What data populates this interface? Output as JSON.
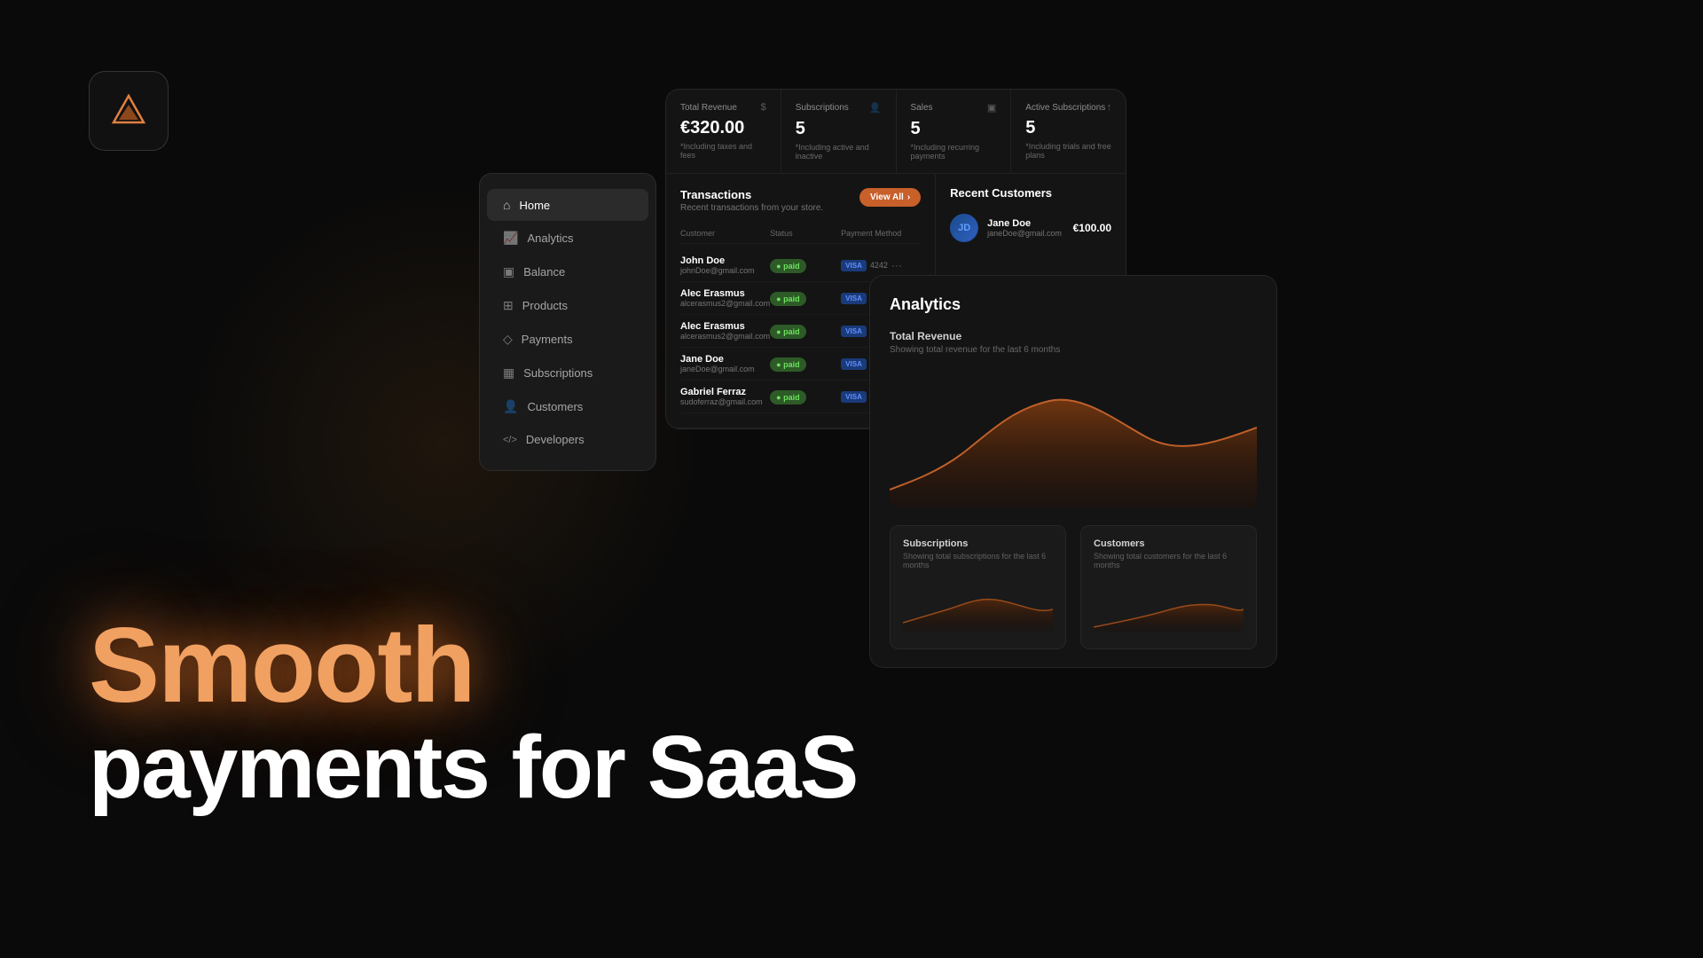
{
  "background": {
    "color": "#0a0a0a"
  },
  "logo": {
    "alt": "Volt logo"
  },
  "hero": {
    "line1": "Smooth",
    "line2": "payments for SaaS"
  },
  "sidebar": {
    "items": [
      {
        "id": "home",
        "label": "Home",
        "icon": "⌂",
        "active": true
      },
      {
        "id": "analytics",
        "label": "Analytics",
        "icon": "📈",
        "active": false
      },
      {
        "id": "balance",
        "label": "Balance",
        "icon": "▣",
        "active": false
      },
      {
        "id": "products",
        "label": "Products",
        "icon": "⊞",
        "active": false
      },
      {
        "id": "payments",
        "label": "Payments",
        "icon": "◇",
        "active": false
      },
      {
        "id": "subscriptions",
        "label": "Subscriptions",
        "icon": "▦",
        "active": false
      },
      {
        "id": "customers",
        "label": "Customers",
        "icon": "👤",
        "active": false
      },
      {
        "id": "developers",
        "label": "Developers",
        "icon": "</>",
        "active": false
      }
    ]
  },
  "stats": [
    {
      "label": "Total Revenue",
      "icon": "$",
      "value": "€320.00",
      "desc": "*Including taxes and fees"
    },
    {
      "label": "Subscriptions",
      "icon": "👤",
      "value": "5",
      "desc": "*Including active and inactive"
    },
    {
      "label": "Sales",
      "icon": "▣",
      "value": "5",
      "desc": "*Including recurring payments"
    },
    {
      "label": "Active Subscriptions",
      "icon": "↑",
      "value": "5",
      "desc": "*Including trials and free plans"
    }
  ],
  "transactions": {
    "title": "Transactions",
    "subtitle": "Recent transactions from your store.",
    "view_all_label": "View All",
    "columns": [
      "Customer",
      "Status",
      "Payment Method"
    ],
    "rows": [
      {
        "name": "John Doe",
        "email": "johnDoe@gmail.com",
        "status": "paid",
        "method": "visa",
        "card": "4242"
      },
      {
        "name": "Alec Erasmus",
        "email": "alcerasmus2@gmail.com",
        "status": "paid",
        "method": "visa",
        "card": ""
      },
      {
        "name": "Alec Erasmus",
        "email": "alcerasmus2@gmail.com",
        "status": "paid",
        "method": "visa",
        "card": ""
      },
      {
        "name": "Jane Doe",
        "email": "janeDoe@gmail.com",
        "status": "paid",
        "method": "visa",
        "card": ""
      },
      {
        "name": "Gabriel Ferraz",
        "email": "sudoferraz@gmail.com",
        "status": "paid",
        "method": "visa",
        "card": ""
      }
    ]
  },
  "recent_customers": {
    "title": "Recent Customers",
    "customers": [
      {
        "name": "Jane Doe",
        "email": "janeDoe@gmail.com",
        "amount": "€100.00",
        "initials": "JD"
      }
    ]
  },
  "analytics": {
    "title": "Analytics",
    "total_revenue": {
      "title": "Total Revenue",
      "subtitle": "Showing total revenue for the last 6 months"
    },
    "subscriptions": {
      "title": "Subscriptions",
      "subtitle": "Showing total subscriptions for the last 6 months"
    },
    "customers": {
      "title": "Customers",
      "subtitle": "Showing total customers for the last 6 months"
    }
  }
}
